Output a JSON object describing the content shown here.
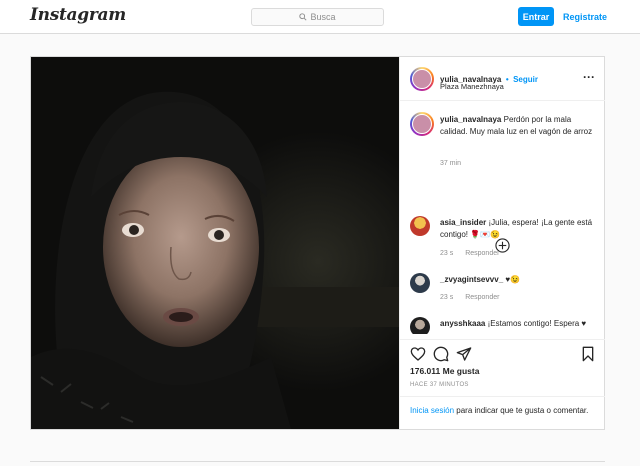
{
  "brand": {
    "logo": "Instagram"
  },
  "search": {
    "placeholder": "Busca"
  },
  "auth": {
    "login": "Entrar",
    "signup": "Registrate"
  },
  "post": {
    "author": "yulia_navalnaya",
    "follow_label": "Seguir",
    "bullet": "•",
    "location": "Plaza Manezhnaya",
    "caption": "Perdón por la mala calidad. Muy mala luz en el vagón de arroz",
    "caption_time": "37 min",
    "comments": [
      {
        "user": "asia_insider",
        "text": "¡Julia, espera! ¡La gente está contigo! 🌹💌😉",
        "time": "23 s",
        "reply": "Responder"
      },
      {
        "user": "_zvyagintsevvv_",
        "text": "♥😉",
        "time": "23 s",
        "reply": "Responder"
      },
      {
        "user": "anysshkaaa",
        "text": "¡Estamos contigo! Espera ♥",
        "time": "",
        "reply": ""
      }
    ],
    "likes": "176.011 Me gusta",
    "ago": "HACE 37 MINUTOS",
    "login_link": "Inicia sesión",
    "login_text": " para indicar que te gusta o comentar."
  }
}
